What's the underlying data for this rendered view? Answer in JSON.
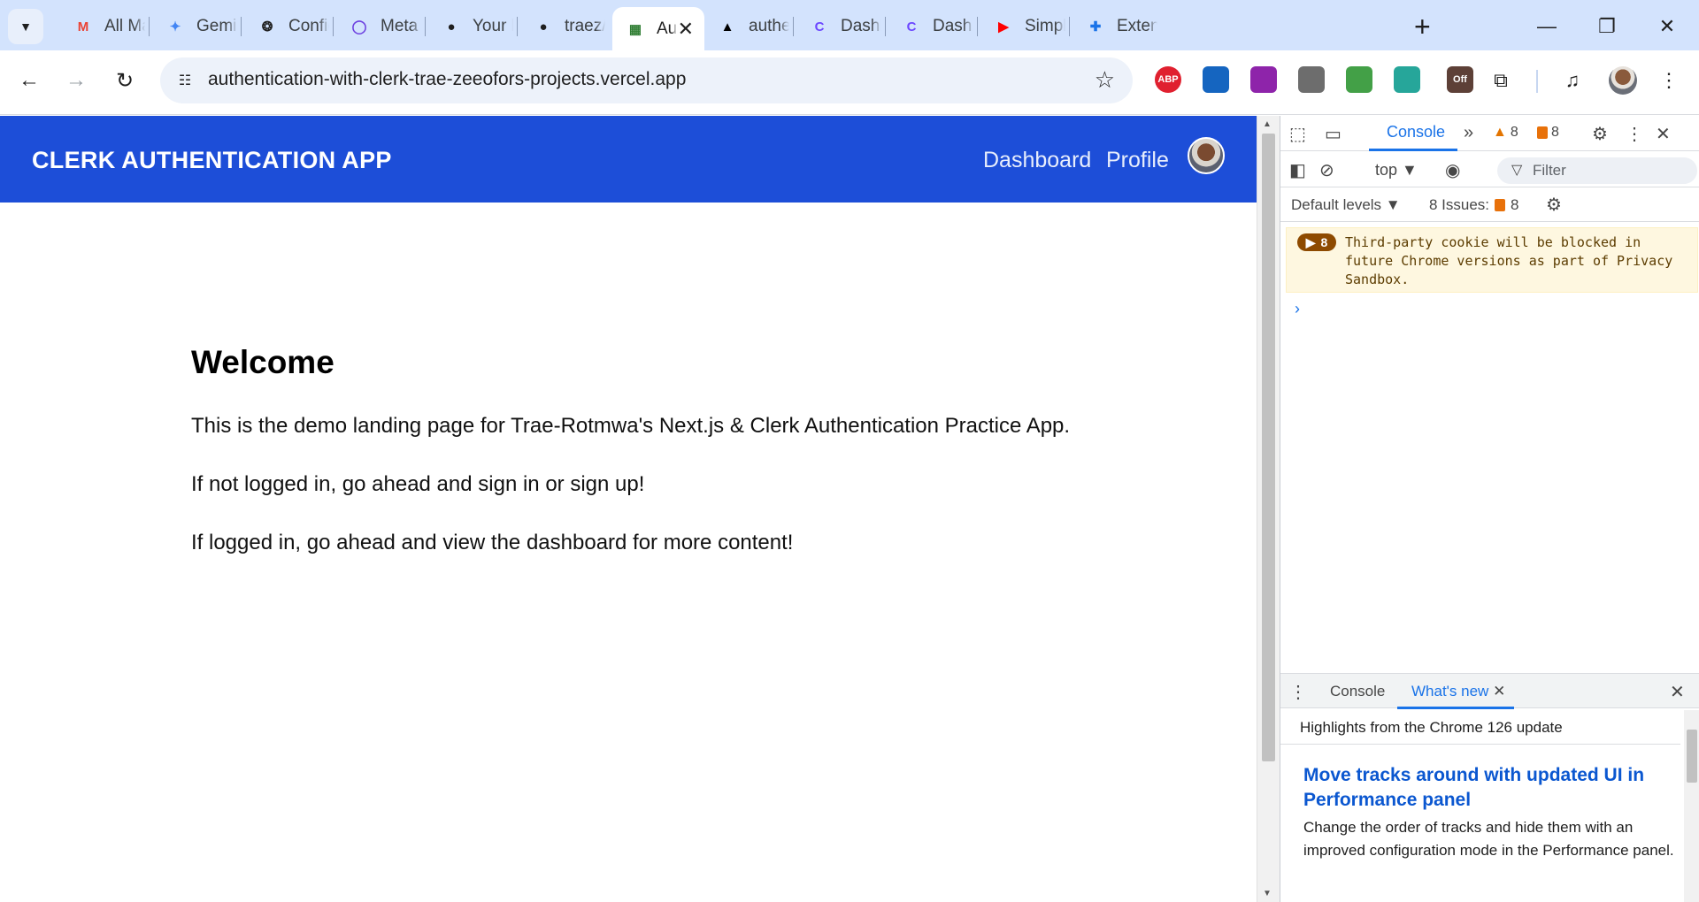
{
  "browser": {
    "tabs": [
      {
        "title": "All Mail",
        "favicon": "gmail-icon",
        "color": "#ea4335"
      },
      {
        "title": "Gemini",
        "favicon": "gemini-icon",
        "color": "#4285f4"
      },
      {
        "title": "Configu",
        "favicon": "openai-icon",
        "color": "#1f1f1f"
      },
      {
        "title": "Meta AI",
        "favicon": "meta-ai-icon",
        "color": "#6c3fe0"
      },
      {
        "title": "Your lis",
        "favicon": "github-icon",
        "color": "#1f1f1f"
      },
      {
        "title": "traez/a",
        "favicon": "github-icon",
        "color": "#1f1f1f"
      },
      {
        "title": "Au",
        "favicon": "app-icon",
        "color": "#2e7d32"
      },
      {
        "title": "authen",
        "favicon": "vercel-icon",
        "color": "#000000"
      },
      {
        "title": "Dashbo",
        "favicon": "clerk-icon",
        "color": "#6c47ff"
      },
      {
        "title": "Dashbo",
        "favicon": "clerk-icon",
        "color": "#6c47ff"
      },
      {
        "title": "Simple",
        "favicon": "youtube-icon",
        "color": "#ff0000"
      },
      {
        "title": "Extensi",
        "favicon": "extensions-icon",
        "color": "#1a73e8"
      }
    ],
    "new_tab": "+",
    "window_controls": {
      "minimize": "—",
      "restore": "❐",
      "close": "✕"
    },
    "url": "authentication-with-clerk-trae-zeeofors-projects.vercel.app",
    "extensions": [
      {
        "name": "adblock-plus-icon",
        "label": "ABP",
        "color": "#e0202f"
      },
      {
        "name": "extension-blue-icon",
        "label": "",
        "color": "#1565c0"
      },
      {
        "name": "extension-circle-icon",
        "label": "",
        "color": "#8e24aa"
      },
      {
        "name": "extension-tool-icon",
        "label": "",
        "color": "#6d6d6d"
      },
      {
        "name": "extension-green-icon",
        "label": "",
        "color": "#43a047"
      },
      {
        "name": "extension-ring-icon",
        "label": "",
        "color": "#26a69a"
      },
      {
        "name": "extension-off-icon",
        "label": "Off",
        "color": "#5d4037"
      }
    ]
  },
  "page": {
    "brand": "CLERK AUTHENTICATION APP",
    "nav": {
      "dashboard": "Dashboard",
      "profile": "Profile"
    },
    "heading": "Welcome",
    "paragraphs": [
      "This is the demo landing page for Trae-Rotmwa's Next.js & Clerk Authentication Practice App.",
      "If not logged in, go ahead and sign in or sign up!",
      "If logged in, go ahead and view the dashboard for more content!"
    ],
    "colors": {
      "appbar": "#1d4ed8"
    }
  },
  "devtools": {
    "panel_tab": "Console",
    "more_tabs": "»",
    "warnings_count": "8",
    "issues_count": "8",
    "context": "top",
    "filter_placeholder": "Filter",
    "levels": "Default levels",
    "issues_label": "8 Issues:",
    "issues_badge": "8",
    "message": {
      "count": "8",
      "text": "Third-party cookie will be blocked in future Chrome versions as part of Privacy Sandbox."
    },
    "prompt": "›",
    "drawer": {
      "tabs": [
        "Console",
        "What's new"
      ],
      "highlights": "Highlights from the Chrome 126 update",
      "article_title": "Move tracks around with updated UI in Performance panel",
      "article_body_1": "Change the order of tracks and hide them with an",
      "article_body_2": "improved configuration mode in the Performance panel."
    }
  }
}
